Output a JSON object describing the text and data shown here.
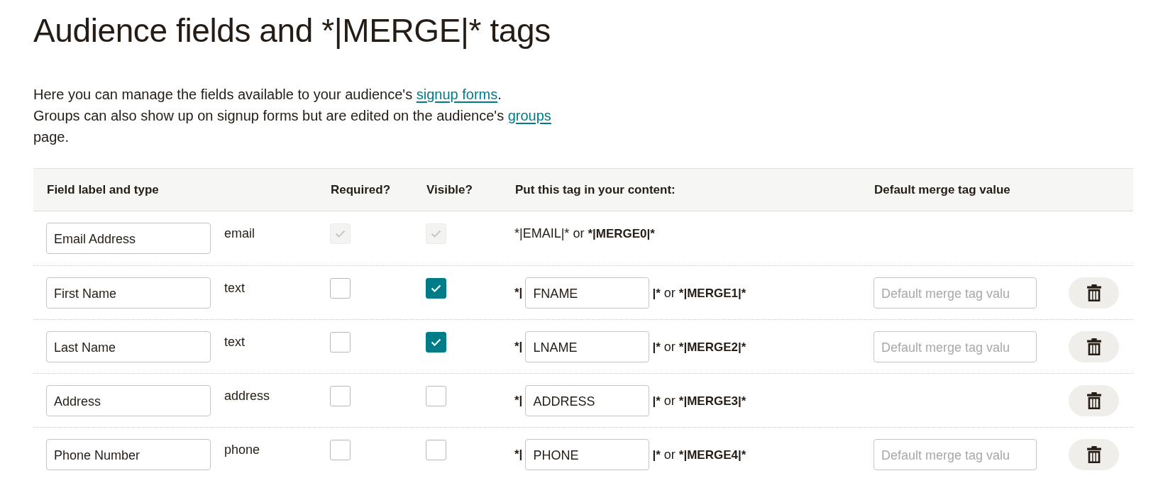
{
  "title": "Audience fields and *|MERGE|* tags",
  "intro": {
    "sentences": [
      {
        "text": "Here you can manage the fields available to your audience's",
        "link": "signup forms",
        "after": "."
      },
      {
        "text": "Groups can also show up on signup forms but are edited on the audience's",
        "link": "groups",
        "after": "page."
      }
    ]
  },
  "table": {
    "columns": [
      "Field label and type",
      "Required?",
      "Visible?",
      "Put this tag in your content:",
      "Default merge tag value"
    ],
    "rows": [
      {
        "kind": "fixed",
        "label": "Email Address",
        "type": "email",
        "required": {
          "checked": true,
          "disabled": true
        },
        "visible": {
          "checked": true,
          "disabled": true
        },
        "tag_line": {
          "plain": "*|EMAIL|* or",
          "bold": "*|MERGE0|*"
        }
      },
      {
        "kind": "editable",
        "label": "First Name",
        "type": "text",
        "required": {
          "checked": false,
          "disabled": false
        },
        "visible": {
          "checked": true,
          "disabled": false
        },
        "tag_open": "*|",
        "tag": "FNAME",
        "tag_close": "|*",
        "joiner": "or",
        "merge_tag": "*|MERGE1|*",
        "default_placeholder": "Default merge tag valu"
      },
      {
        "kind": "editable",
        "label": "Last Name",
        "type": "text",
        "required": {
          "checked": false,
          "disabled": false
        },
        "visible": {
          "checked": true,
          "disabled": false
        },
        "tag_open": "*|",
        "tag": "LNAME",
        "tag_close": "|*",
        "joiner": "or",
        "merge_tag": "*|MERGE2|*",
        "default_placeholder": "Default merge tag valu"
      },
      {
        "kind": "editable",
        "label": "Address",
        "type": "address",
        "required": {
          "checked": false,
          "disabled": false
        },
        "visible": {
          "checked": false,
          "disabled": false
        },
        "tag_open": "*|",
        "tag": "ADDRESS",
        "tag_close": "|*",
        "joiner": "or",
        "merge_tag": "*|MERGE3|*"
      },
      {
        "kind": "editable",
        "label": "Phone Number",
        "type": "phone",
        "required": {
          "checked": false,
          "disabled": false
        },
        "visible": {
          "checked": false,
          "disabled": false
        },
        "tag_open": "*|",
        "tag": "PHONE",
        "tag_close": "|*",
        "joiner": "or",
        "merge_tag": "*|MERGE4|*",
        "default_placeholder": "Default merge tag valu"
      }
    ]
  }
}
